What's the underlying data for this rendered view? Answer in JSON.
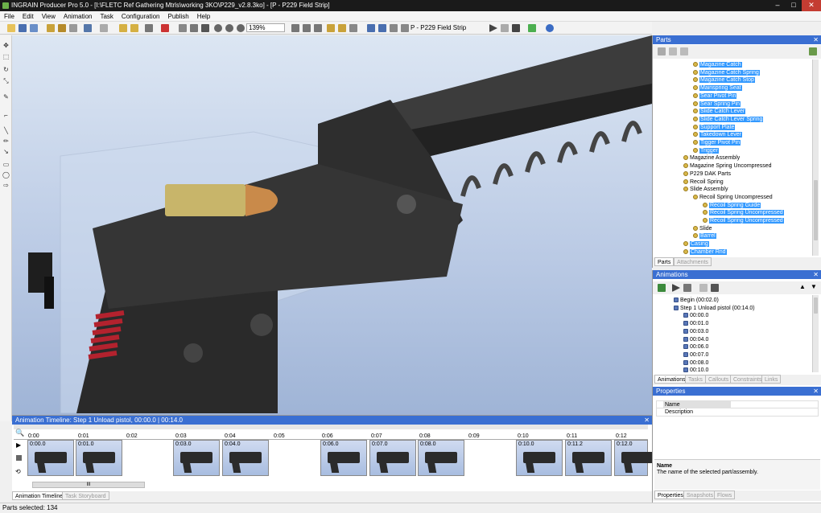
{
  "window": {
    "title": "INGRAIN Producer Pro 5.0 - [I:\\FLETC Ref Gathering Mtrls\\working 3KO\\P229_v2.8.3ko] - [P - P229 Field Strip]",
    "min": "–",
    "max": "□",
    "close": "✕"
  },
  "menu": [
    "File",
    "Edit",
    "View",
    "Animation",
    "Task",
    "Configuration",
    "Publish",
    "Help"
  ],
  "toolbar": {
    "zoom": "139%",
    "snapshot": "P - P229 Field Strip"
  },
  "timeline": {
    "title": "Animation Timeline: Step 1 Unload pistol, 00:00.0 | 00:14.0",
    "ticks": [
      "0:00",
      "0:01",
      "0:02",
      "0:03",
      "0:04",
      "0:05",
      "0:06",
      "0:07",
      "0:08",
      "0:09",
      "0:10",
      "0:11",
      "0:12"
    ],
    "frames": [
      {
        "label": "0:00.0"
      },
      {
        "label": "0:01.0"
      },
      {
        "label": "0:03.0"
      },
      {
        "label": "0:04.0"
      },
      {
        "label": "0:06.0"
      },
      {
        "label": "0:07.0"
      },
      {
        "label": "0:08.0"
      },
      {
        "label": "0:10.0"
      },
      {
        "label": "0:11.2"
      },
      {
        "label": "0:12.0"
      }
    ],
    "hscroll": "III",
    "tabs": [
      "Animation Timeline",
      "Task Storyboard"
    ]
  },
  "status": {
    "text": "Parts selected: 134"
  },
  "parts": {
    "title": "Parts",
    "items": [
      {
        "label": "Magazine Catch",
        "sel": true,
        "indent": 3
      },
      {
        "label": "Magazine Catch Spring",
        "sel": true,
        "indent": 3
      },
      {
        "label": "Magazine Catch Stop",
        "sel": true,
        "indent": 3
      },
      {
        "label": "Mainspring Seat",
        "sel": true,
        "indent": 3
      },
      {
        "label": "Sear Pivot Pin",
        "sel": true,
        "indent": 3
      },
      {
        "label": "Sear Spring Pin",
        "sel": true,
        "indent": 3
      },
      {
        "label": "Slide Catch Lever",
        "sel": true,
        "indent": 3
      },
      {
        "label": "Slide Catch Lever Spring",
        "sel": true,
        "indent": 3
      },
      {
        "label": "Support Plate",
        "sel": true,
        "indent": 3
      },
      {
        "label": "Takedown Lever",
        "sel": true,
        "indent": 3
      },
      {
        "label": "Tigger Pivot Pin",
        "sel": true,
        "indent": 3
      },
      {
        "label": "Trigger",
        "sel": true,
        "indent": 3
      },
      {
        "label": "Magazine Assembly",
        "sel": false,
        "indent": 2
      },
      {
        "label": "Magazine Spring Uncompressed",
        "sel": false,
        "indent": 2
      },
      {
        "label": "P229 DAK Parts",
        "sel": false,
        "indent": 2
      },
      {
        "label": "Recoil Spring",
        "sel": false,
        "indent": 2
      },
      {
        "label": "Slide Assembly",
        "sel": false,
        "indent": 2
      },
      {
        "label": "Recoil Spring Uncompressed",
        "sel": false,
        "indent": 3
      },
      {
        "label": "Recoil Spring Guide",
        "sel": true,
        "indent": 4
      },
      {
        "label": "Recoil Spring Uncompressed",
        "sel": true,
        "indent": 4
      },
      {
        "label": "Recoil Spring Uncompressed",
        "sel": true,
        "indent": 4
      },
      {
        "label": "Slide",
        "sel": false,
        "indent": 3
      },
      {
        "label": "Barrel",
        "sel": true,
        "indent": 3
      },
      {
        "label": "Casing",
        "sel": true,
        "indent": 2
      },
      {
        "label": "Chamber Rnd",
        "sel": true,
        "indent": 2
      }
    ],
    "tabs": [
      "Parts",
      "Attachments"
    ]
  },
  "animations": {
    "title": "Animations",
    "items": [
      {
        "label": "Begin (00:02.0)",
        "indent": 1
      },
      {
        "label": "Step 1 Unload pistol (00:14.0)",
        "indent": 1
      },
      {
        "label": "00:00.0",
        "indent": 2
      },
      {
        "label": "00:01.0",
        "indent": 2
      },
      {
        "label": "00:03.0",
        "indent": 2
      },
      {
        "label": "00:04.0",
        "indent": 2
      },
      {
        "label": "00:06.0",
        "indent": 2
      },
      {
        "label": "00:07.0",
        "indent": 2
      },
      {
        "label": "00:08.0",
        "indent": 2
      },
      {
        "label": "00:10.0",
        "indent": 2
      }
    ],
    "tabs": [
      "Animations",
      "Tasks",
      "Callouts",
      "Constraints",
      "Links"
    ]
  },
  "properties": {
    "title": "Properties",
    "rows": [
      {
        "name": "Name",
        "value": ""
      },
      {
        "name": "Description",
        "value": ""
      }
    ],
    "help_title": "Name",
    "help_text": "The name of the selected part/assembly.",
    "tabs": [
      "Properties",
      "Snapshots",
      "Flows"
    ]
  },
  "colors": {
    "accent": "#3399ff",
    "panel_header_active": "#3a6fd2"
  }
}
